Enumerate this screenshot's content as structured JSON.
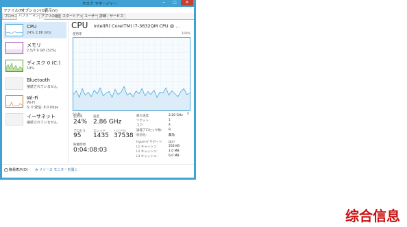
{
  "window": {
    "title": "タスク マネージャー",
    "minimize_glyph": "−",
    "maximize_glyph": "□",
    "close_glyph": "✕"
  },
  "menubar": [
    "ファイル(F)",
    "オプション(O)",
    "表示(V)"
  ],
  "tabs": [
    {
      "label": "プロセス",
      "active": false
    },
    {
      "label": "パフォーマンス",
      "active": true
    },
    {
      "label": "アプリの履歴",
      "active": false
    },
    {
      "label": "スタートアップ",
      "active": false
    },
    {
      "label": "ユーザー",
      "active": false
    },
    {
      "label": "詳細",
      "active": false
    },
    {
      "label": "サービス",
      "active": false
    }
  ],
  "sidebar": {
    "items": [
      {
        "name": "CPU",
        "sub1": "24%  2.86 GHz",
        "sub2": "",
        "color": "#4ea8d8"
      },
      {
        "name": "メモリ",
        "sub1": "2.5/7.9 GB (32%)",
        "sub2": "",
        "color": "#9b3bb0"
      },
      {
        "name": "ディスク 0 (C:)",
        "sub1": "19%",
        "sub2": "",
        "color": "#4f9a2a"
      },
      {
        "name": "Bluetooth",
        "sub1": "接続されていません",
        "sub2": "",
        "color": "#cccccc"
      },
      {
        "name": "Wi-Fi",
        "sub1": "Wi-Fi",
        "sub2": "S: 0  受信: 8.0 Kbps",
        "color": "#c8702a"
      },
      {
        "name": "イーサネット",
        "sub1": "接続されていません",
        "sub2": "",
        "color": "#cccccc"
      }
    ]
  },
  "main": {
    "title": "CPU",
    "model": "Intel(R) Core(TM) i7-3632QM CPU @ ...",
    "graph_label_left": "使用率",
    "graph_label_right": "100%",
    "axis_left": "60 秒",
    "axis_right": "0",
    "stats": {
      "usage_label": "使用率",
      "usage_value": "24%",
      "speed_label": "速度",
      "speed_value": "2.86 GHz",
      "process_label": "プロセス",
      "process_value": "95",
      "thread_label": "スレッド",
      "thread_value": "1435",
      "handle_label": "ハンドル",
      "handle_value": "37538",
      "uptime_label": "稼働時間",
      "uptime_value": "0:04:08:03"
    },
    "info": [
      {
        "label": "最大速度:",
        "value": "2.20 GHz"
      },
      {
        "label": "ソケット:",
        "value": "1"
      },
      {
        "label": "コア:",
        "value": "4"
      },
      {
        "label": "論理プロセッサ数:",
        "value": "8"
      },
      {
        "label": "仮想化:",
        "value": "無効"
      },
      {
        "label": "Hyper-V サポート:",
        "value": "はい"
      },
      {
        "label": "L1 キャッシュ:",
        "value": "256 KB"
      },
      {
        "label": "L2 キャッシュ:",
        "value": "1.0 MB"
      },
      {
        "label": "L3 キャッシュ:",
        "value": "6.0 MB"
      }
    ],
    "cpu_history_percent": [
      22,
      27,
      18,
      30,
      21,
      25,
      19,
      28,
      23,
      31,
      20,
      24,
      26,
      18,
      29,
      22,
      25,
      33,
      21,
      24,
      19,
      27,
      23,
      30,
      20,
      26,
      22,
      28,
      18,
      25,
      24,
      31,
      21,
      27,
      23,
      19,
      26,
      30,
      22,
      24
    ]
  },
  "footer": {
    "less_details": "簡易表示(D)",
    "resource_monitor": "リソース モニターを開く"
  },
  "watermark": "综合信息"
}
